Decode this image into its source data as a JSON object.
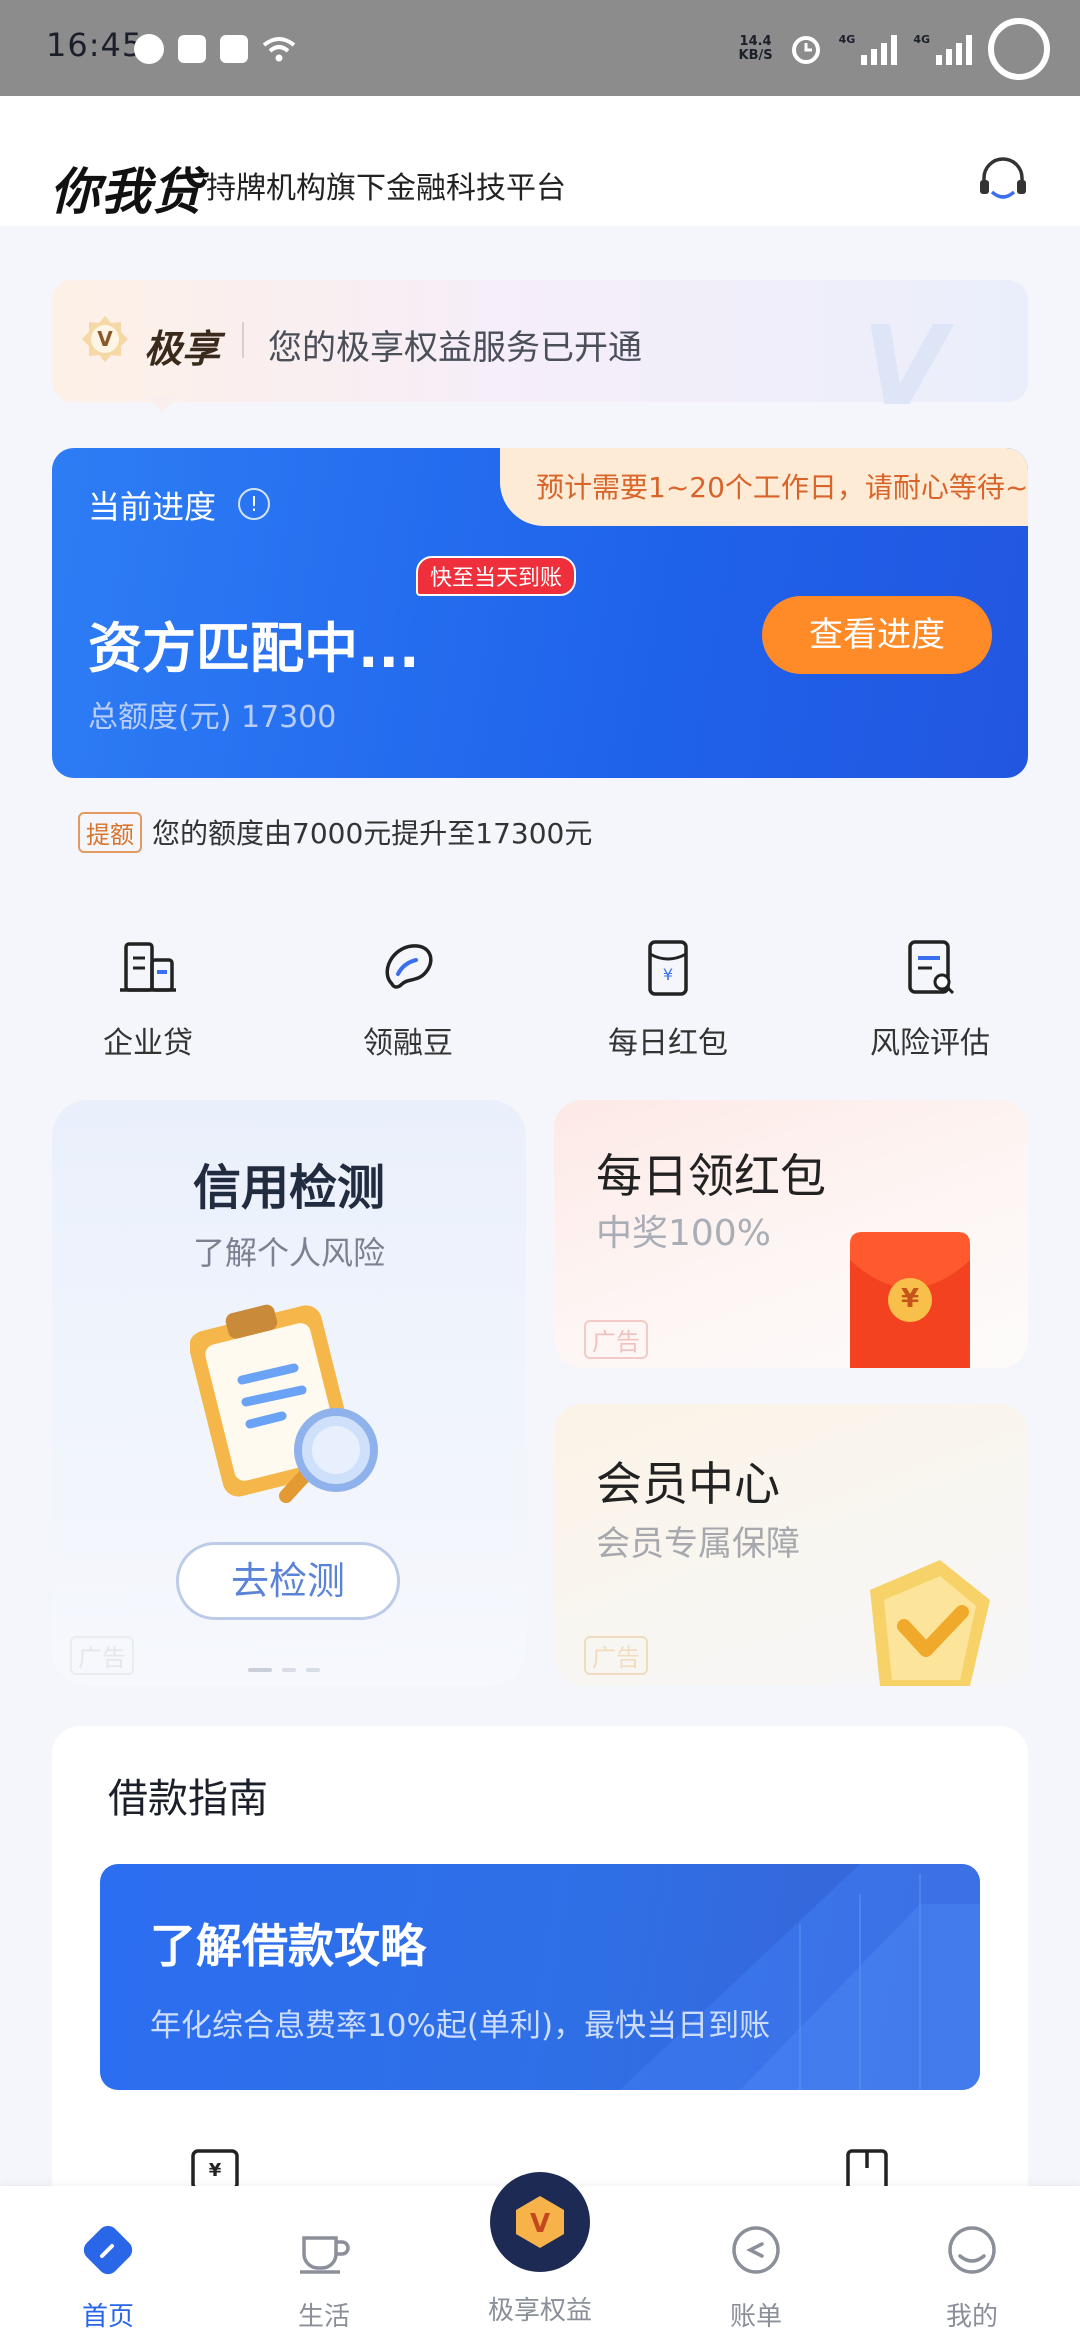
{
  "status_bar": {
    "time": "16:45",
    "net_speed_value": "14.4",
    "net_speed_unit": "KB/S",
    "signal1_label": "4G",
    "signal2_label": "4G"
  },
  "header": {
    "logo": "你我贷",
    "slogan": "持牌机构旗下金融科技平台",
    "support_icon": "headset-icon"
  },
  "vip_banner": {
    "title": "极享",
    "text": "您的极享权益服务已开通",
    "badge_letter": "V"
  },
  "progress": {
    "label": "当前进度",
    "info_icon": "!",
    "notice": "预计需要1~20个工作日，请耐心等待~",
    "fast_badge": "快至当天到账",
    "status": "资方匹配中...",
    "amount": "总额度(元) 17300",
    "button": "查看进度",
    "raise_tag": "提额",
    "raise_text": "您的额度由7000元提升至17300元"
  },
  "quick_menu": [
    {
      "label": "企业贷",
      "icon": "building-icon"
    },
    {
      "label": "领融豆",
      "icon": "bean-icon"
    },
    {
      "label": "每日红包",
      "icon": "red-packet-icon"
    },
    {
      "label": "风险评估",
      "icon": "risk-report-icon"
    }
  ],
  "credit_card": {
    "title": "信用检测",
    "subtitle": "了解个人风险",
    "button": "去检测",
    "ad": "广告"
  },
  "red_packet_card": {
    "title": "每日领红包",
    "subtitle": "中奖100%",
    "ad": "广告",
    "coin_symbol": "¥"
  },
  "member_card": {
    "title": "会员中心",
    "subtitle": "会员专属保障",
    "ad": "广告"
  },
  "guide": {
    "title": "借款指南",
    "banner_title": "了解借款攻略",
    "banner_sub": "年化综合息费率10%起(单利)，最快当日到账"
  },
  "tabs": [
    {
      "label": "首页",
      "active": true
    },
    {
      "label": "生活",
      "active": false
    },
    {
      "label": "极享权益",
      "active": false
    },
    {
      "label": "账单",
      "active": false
    },
    {
      "label": "我的",
      "active": false
    }
  ],
  "colors": {
    "primary": "#2a66e8",
    "accent_orange": "#ff8a28",
    "badge_red": "#ef2f3b"
  }
}
